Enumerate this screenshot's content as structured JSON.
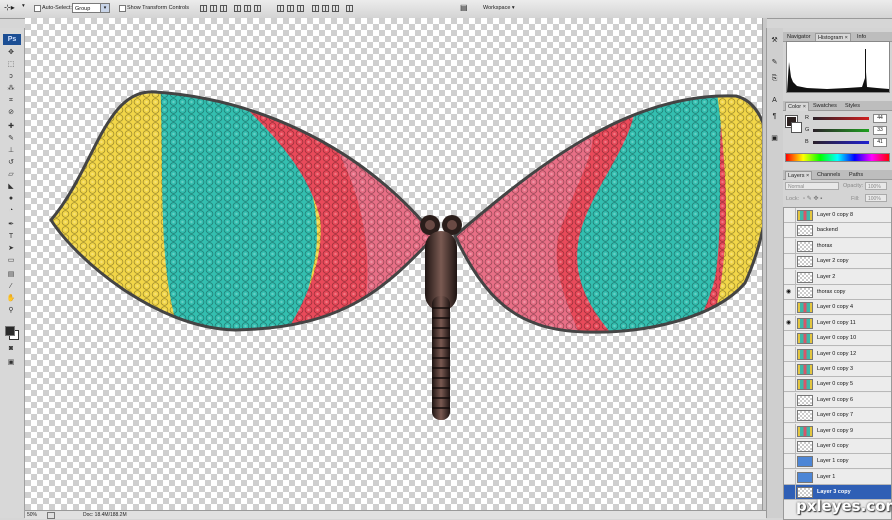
{
  "options_bar": {
    "auto_select_label": "Auto-Select:",
    "auto_select_value": "Group",
    "show_transform_label": "Show Transform Controls",
    "workspace_label": "Workspace ▾"
  },
  "tools": {
    "logo": "Ps",
    "foreground_color": "#2a2a2a",
    "background_color": "#ffffff"
  },
  "status": {
    "zoom": "50%",
    "doc_info": "Doc: 18.4M/188.2M"
  },
  "navigator_tabs": [
    "Navigator",
    "Histogram",
    "Info"
  ],
  "color_panel": {
    "tabs": [
      "Color",
      "Swatches",
      "Styles"
    ],
    "channels": [
      {
        "label": "R",
        "value": "44",
        "color": "#d02020"
      },
      {
        "label": "G",
        "value": "33",
        "color": "#20a020"
      },
      {
        "label": "B",
        "value": "41",
        "color": "#2020d0"
      }
    ]
  },
  "layers_panel": {
    "tabs": [
      "Layers",
      "Channels",
      "Paths"
    ],
    "blend_mode": "Normal",
    "opacity_label": "Opacity:",
    "opacity_value": "100%",
    "lock_label": "Lock:",
    "fill_label": "Fill:",
    "fill_value": "100%",
    "layers": [
      {
        "name": "Layer 0 copy 8",
        "visible": false,
        "thumb": "wing",
        "selected": false
      },
      {
        "name": "backend",
        "visible": false,
        "thumb": "checker",
        "selected": false
      },
      {
        "name": "thorax",
        "visible": false,
        "thumb": "checker",
        "selected": false
      },
      {
        "name": "Layer 2 copy",
        "visible": false,
        "thumb": "checker",
        "selected": false
      },
      {
        "name": "Layer 2",
        "visible": false,
        "thumb": "checker",
        "selected": false
      },
      {
        "name": "thorax copy",
        "visible": true,
        "thumb": "checker",
        "selected": false
      },
      {
        "name": "Layer 0 copy 4",
        "visible": false,
        "thumb": "wing",
        "selected": false
      },
      {
        "name": "Layer 0 copy 11",
        "visible": true,
        "thumb": "wing",
        "selected": false
      },
      {
        "name": "Layer 0 copy 10",
        "visible": false,
        "thumb": "wing",
        "selected": false
      },
      {
        "name": "Layer 0 copy 12",
        "visible": false,
        "thumb": "wing",
        "selected": false
      },
      {
        "name": "Layer 0 copy 3",
        "visible": false,
        "thumb": "wing",
        "selected": false
      },
      {
        "name": "Layer 0 copy 5",
        "visible": false,
        "thumb": "wing",
        "selected": false
      },
      {
        "name": "Layer 0 copy 6",
        "visible": false,
        "thumb": "checker",
        "selected": false
      },
      {
        "name": "Layer 0 copy 7",
        "visible": false,
        "thumb": "checker",
        "selected": false
      },
      {
        "name": "Layer 0 copy 9",
        "visible": false,
        "thumb": "wing",
        "selected": false
      },
      {
        "name": "Layer 0 copy",
        "visible": false,
        "thumb": "checker",
        "selected": false
      },
      {
        "name": "Layer 1 copy",
        "visible": false,
        "thumb": "blue",
        "selected": false
      },
      {
        "name": "Layer 1",
        "visible": false,
        "thumb": "blue",
        "selected": false
      },
      {
        "name": "Layer 3 copy",
        "visible": false,
        "thumb": "checker",
        "selected": true
      }
    ]
  },
  "artwork_colors": {
    "yellow": "#f2d648",
    "teal": "#33bfb0",
    "pink": "#e86f86",
    "red": "#e94a5a",
    "body": "#3a2622"
  },
  "watermark": "pxleyes.com"
}
